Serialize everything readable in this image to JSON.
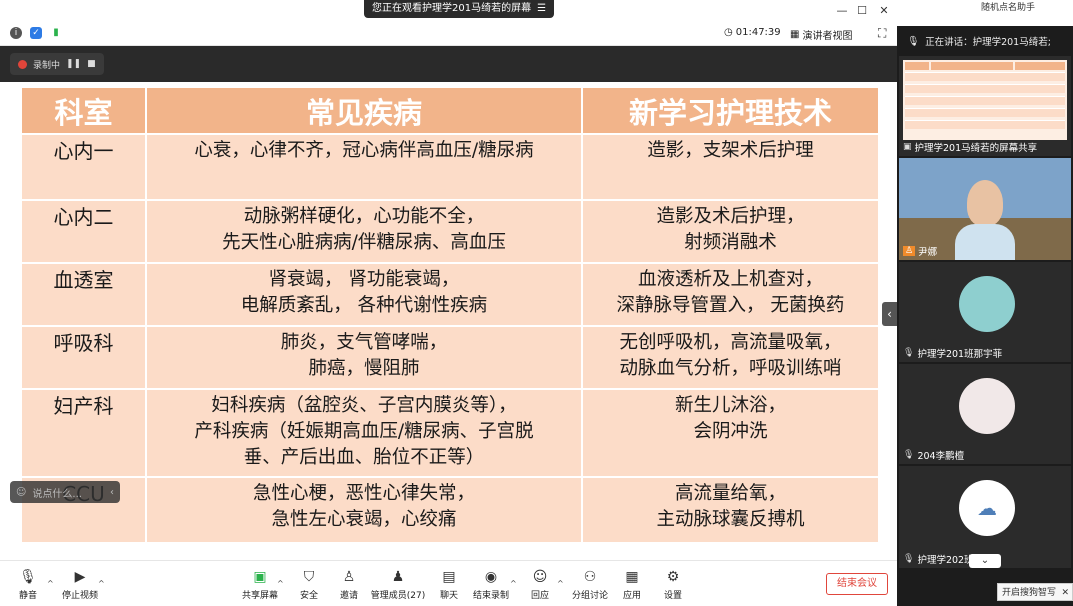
{
  "window": {
    "share_banner": "您正在观看护理学201马绮若的屏幕",
    "timer": "01:47:39",
    "view_mode": "演讲者视图"
  },
  "recording": {
    "label": "录制中"
  },
  "slide": {
    "headers": [
      "科室",
      "常见疾病",
      "新学习护理技术"
    ],
    "rows": [
      {
        "dept": "心内一",
        "diseases": [
          "心衰，心律不齐，冠心病伴高血压/糖尿病"
        ],
        "tech": [
          "造影，支架术后护理"
        ]
      },
      {
        "dept": "心内二",
        "diseases": [
          "动脉粥样硬化，心功能不全，",
          "先天性心脏病病/伴糖尿病、高血压"
        ],
        "tech": [
          "造影及术后护理，",
          "射频消融术"
        ]
      },
      {
        "dept": "血透室",
        "diseases": [
          "肾衰竭， 肾功能衰竭，",
          "电解质紊乱， 各种代谢性疾病"
        ],
        "tech": [
          "血液透析及上机查对，",
          "深静脉导管置入， 无菌换药"
        ]
      },
      {
        "dept": "呼吸科",
        "diseases": [
          "肺炎，支气管哮喘，",
          "肺癌，慢阻肺"
        ],
        "tech": [
          "无创呼吸机，高流量吸氧，",
          "动脉血气分析，呼吸训练哨"
        ]
      },
      {
        "dept": "妇产科",
        "diseases": [
          "妇科疾病（盆腔炎、子宫内膜炎等），",
          "产科疾病（妊娠期高血压/糖尿病、子宫脱",
          "垂、产后出血、胎位不正等）"
        ],
        "tech": [
          "新生儿沐浴，",
          "会阴冲洗"
        ]
      },
      {
        "dept": "CCU",
        "diseases": [
          "急性心梗，恶性心律失常，",
          "急性左心衰竭，心绞痛"
        ],
        "tech": [
          "高流量给氧，",
          "主动脉球囊反搏机"
        ]
      }
    ]
  },
  "chat_float": {
    "placeholder": "说点什么..."
  },
  "toolbar": {
    "items": [
      "静音",
      "停止视频",
      "共享屏幕",
      "安全",
      "邀请",
      "管理成员(27)",
      "聊天",
      "结束录制",
      "回应",
      "分组讨论",
      "应用",
      "设置"
    ],
    "end_meeting": "结束会议"
  },
  "panel": {
    "top_text": "随机点名助手",
    "speaking": "正在讲话：护理学201马绮若;",
    "tiles": [
      {
        "name": "护理学201马绮若的屏幕共享"
      },
      {
        "name": "尹娜"
      },
      {
        "name": "护理学201班那宇菲"
      },
      {
        "name": "204李鹏檀"
      },
      {
        "name": "护理学202班张"
      }
    ],
    "sogou_tip": "开启搜狗智写"
  },
  "colors": {
    "header_bg": "#f2b48a",
    "cell_bg": "#fcdcc8",
    "end_red": "#e0463c"
  }
}
